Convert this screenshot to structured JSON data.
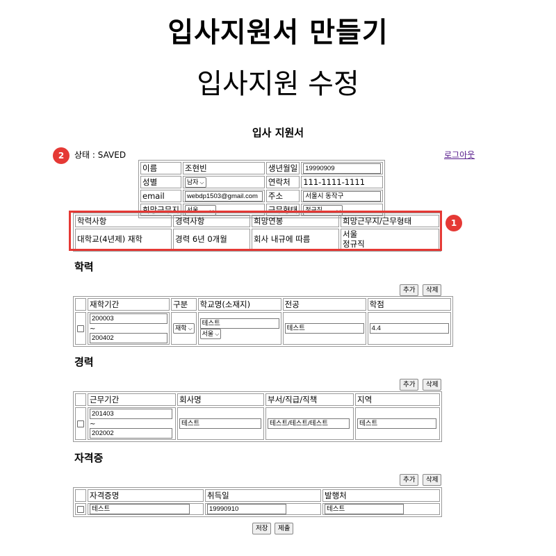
{
  "header": {
    "title": "입사지원서 만들기",
    "subtitle": "입사지원 수정"
  },
  "form_title": "입사 지원서",
  "status": {
    "label": "상태 : SAVED",
    "badge": "2"
  },
  "logout": "로그아웃",
  "personal": {
    "name_label": "이름",
    "name": "조현빈",
    "birth_label": "생년월일",
    "birth": "19990909",
    "gender_label": "성별",
    "gender": "남자",
    "phone_label": "연락처",
    "phone": "111-1111-1111",
    "email_label": "email",
    "email": "webdp1503@gmail.com",
    "address_label": "주소",
    "address": "서울시 동작구",
    "region_label": "희망근무지",
    "region": "서울",
    "worktype_label": "근무형태",
    "worktype": "정규직"
  },
  "summary": {
    "badge": "1",
    "headers": [
      "학력사항",
      "경력사항",
      "희망연봉",
      "희망근무지/근무형태"
    ],
    "values": [
      "대학교(4년제) 재학",
      "경력 6년 0개월",
      "회사 내규에 따름",
      "서울",
      "정규직"
    ]
  },
  "buttons": {
    "add": "추가",
    "delete": "삭제",
    "save": "저장",
    "submit": "제출"
  },
  "education": {
    "title": "학력",
    "headers": [
      "재학기간",
      "구분",
      "학교명(소재지)",
      "전공",
      "학점"
    ],
    "row": {
      "start": "200003",
      "tilde": "~",
      "end": "200402",
      "type": "재학",
      "school": "테스트",
      "location": "서울",
      "major": "테스트",
      "grade": "4.4"
    }
  },
  "career": {
    "title": "경력",
    "headers": [
      "근무기간",
      "회사명",
      "부서/직급/직책",
      "지역"
    ],
    "row": {
      "start": "201403",
      "tilde": "~",
      "end": "202002",
      "company": "테스트",
      "dept": "테스트/테스트/테스트",
      "region": "테스트"
    }
  },
  "license": {
    "title": "자격증",
    "headers": [
      "자격증명",
      "취득일",
      "발행처"
    ],
    "row": {
      "name": "테스트",
      "date": "19990910",
      "issuer": "테스트"
    }
  },
  "colors": {
    "highlight": "#e53935",
    "link": "#551a8b"
  }
}
